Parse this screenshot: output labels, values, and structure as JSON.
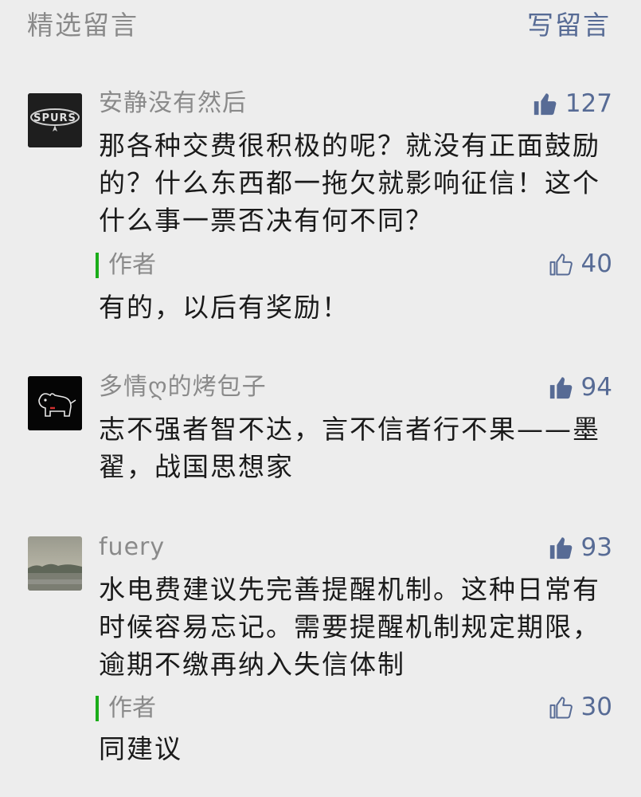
{
  "header": {
    "title": "精选留言",
    "write_label": "写留言"
  },
  "comments": [
    {
      "nickname": "安静没有然后",
      "likes": "127",
      "liked": true,
      "avatar_icon": "spurs-logo-avatar",
      "text": "那各种交费很积极的呢？就没有正面鼓励的？什么东西都一拖欠就影响征信！这个什么事一票否决有何不同？",
      "reply": {
        "label": "作者",
        "likes": "40",
        "text": "有的，以后有奖励！"
      }
    },
    {
      "nickname": "多情ღ的烤包子",
      "likes": "94",
      "liked": true,
      "avatar_icon": "dog-avatar",
      "text": "志不强者智不达，言不信者行不果——墨翟，战国思想家"
    },
    {
      "nickname": "fuery",
      "likes": "93",
      "liked": true,
      "avatar_icon": "landscape-avatar",
      "text": "水电费建议先完善提醒机制。这种日常有时候容易忘记。需要提醒机制规定期限，逾期不缴再纳入失信体制",
      "reply": {
        "label": "作者",
        "likes": "30",
        "text": "同建议"
      }
    }
  ],
  "colors": {
    "background": "#ededed",
    "link": "#576b95",
    "secondary_text": "#8a8a8a",
    "author_bar": "#1aad19"
  }
}
